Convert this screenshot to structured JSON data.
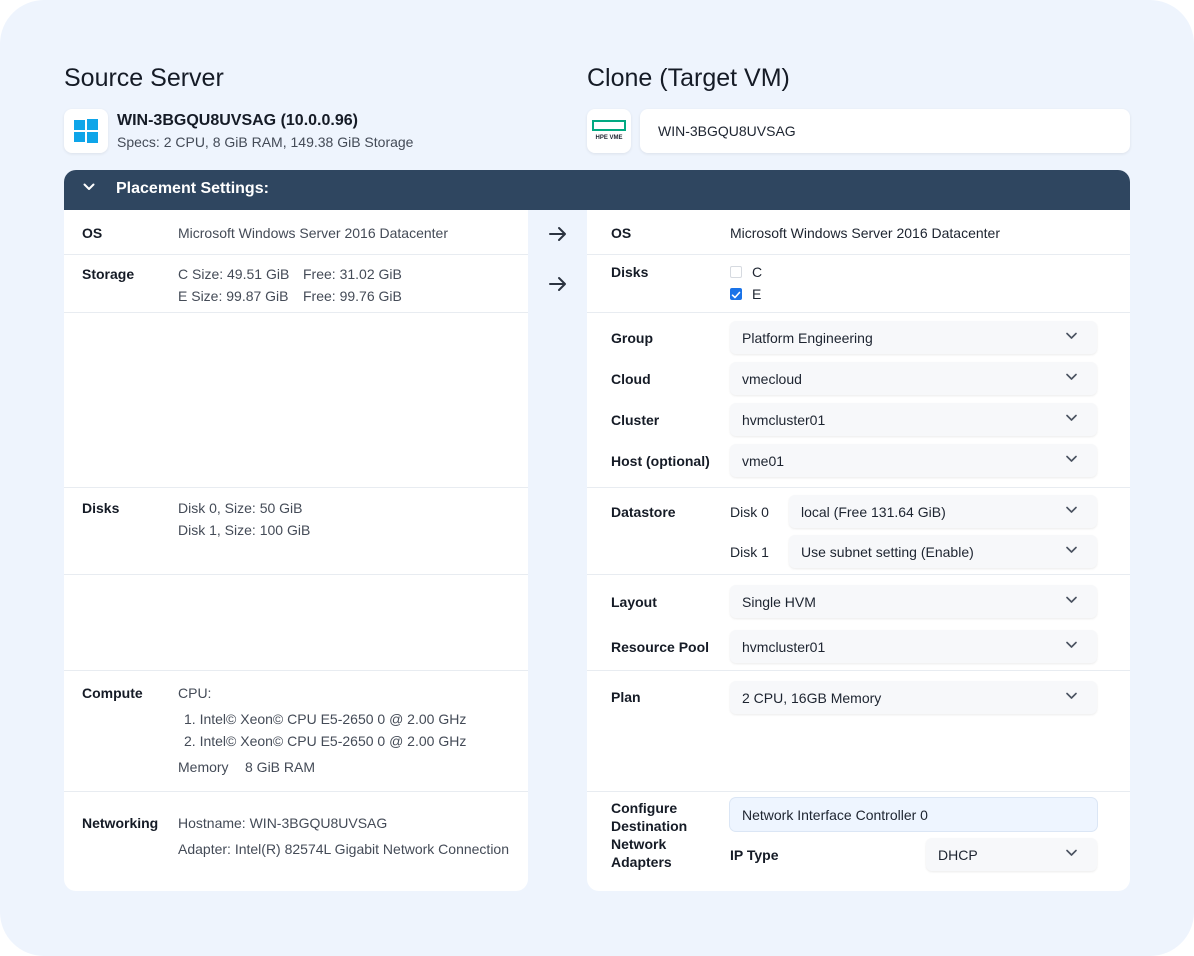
{
  "source": {
    "heading": "Source Server",
    "icon": "windows-logo-icon",
    "name": "WIN-3BGQU8UVSAG (10.0.0.96)",
    "specs": "Specs: 2 CPU, 8 GiB RAM, 149.38 GiB Storage",
    "os_label": "OS",
    "os_value": "Microsoft Windows Server 2016 Datacenter",
    "storage_label": "Storage",
    "storage": [
      {
        "size": "C Size: 49.51 GiB",
        "free": "Free: 31.02 GiB"
      },
      {
        "size": "E Size: 99.87 GiB",
        "free": "Free: 99.76 GiB"
      }
    ],
    "disks_label": "Disks",
    "disks": [
      "Disk 0, Size: 50 GiB",
      "Disk 1, Size: 100 GiB"
    ],
    "compute_label": "Compute",
    "cpu_label": "CPU:",
    "cpus": [
      "1.  Intel© Xeon© CPU E5-2650 0 @ 2.00 GHz",
      "2.  Intel© Xeon© CPU E5-2650 0 @ 2.00 GHz"
    ],
    "memory_label": "Memory",
    "memory_value": "8 GiB RAM",
    "networking_label": "Networking",
    "hostname": "Hostname: WIN-3BGQU8UVSAG",
    "adapter": "Adapter: Intel(R) 82574L Gigabit Network Connection"
  },
  "target": {
    "heading": "Clone (Target VM)",
    "icon": "hpe-vme-logo-icon",
    "logo_text": "HPE VME",
    "name_value": "WIN-3BGQU8UVSAG",
    "os_label": "OS",
    "os_value": "Microsoft Windows Server 2016 Datacenter",
    "disks_label": "Disks",
    "disk_options": [
      {
        "label": "C",
        "checked": false
      },
      {
        "label": "E",
        "checked": true
      }
    ],
    "group_label": "Group",
    "group_value": "Platform Engineering",
    "cloud_label": "Cloud",
    "cloud_value": "vmecloud",
    "cluster_label": "Cluster",
    "cluster_value": "hvmcluster01",
    "host_label": "Host (optional)",
    "host_value": "vme01",
    "datastore_label": "Datastore",
    "disk0_label": "Disk 0",
    "disk0_value": "local (Free 131.64 GiB)",
    "disk1_label": "Disk 1",
    "disk1_value": "Use subnet setting (Enable)",
    "layout_label": "Layout",
    "layout_value": "Single HVM",
    "pool_label": "Resource Pool",
    "pool_value": "hvmcluster01",
    "plan_label": "Plan",
    "plan_value": "2 CPU, 16GB Memory",
    "network_label_lines": [
      "Configure",
      "Destination",
      "Network",
      "Adapters"
    ],
    "nic_value": "Network Interface Controller 0",
    "ip_type_label": "IP Type",
    "ip_type_value": "DHCP"
  },
  "placement": {
    "title": "Placement Settings:"
  },
  "colors": {
    "background": "#eef4fd",
    "header_bar": "#2f4660",
    "checkbox_checked": "#1a73e8",
    "windows_blue": "#0ea5e9",
    "hpe_green": "#01a982"
  }
}
